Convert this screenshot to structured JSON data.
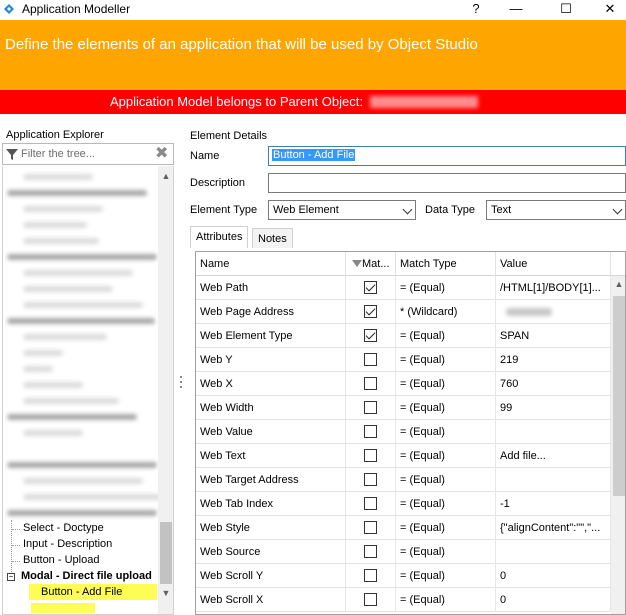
{
  "window": {
    "title": "Application Modeller",
    "help_glyph": "?",
    "minimize_glyph": "—",
    "maximize_glyph": "☐",
    "close_glyph": "✕"
  },
  "banner": {
    "text": "Define the elements of an application that will be used by Object Studio",
    "color": "#ffa500"
  },
  "parent_bar": {
    "text": "Application Model belongs to Parent Object:",
    "color": "#fe0000"
  },
  "explorer": {
    "label": "Application Explorer",
    "filter_placeholder": "Filter the tree...",
    "clear_glyph": "✖",
    "items": [
      {
        "label": "Select - Doctype"
      },
      {
        "label": "Input - Description"
      },
      {
        "label": "Button - Upload"
      },
      {
        "label": "Modal - Direct file upload",
        "expander": "−"
      },
      {
        "label": "Button - Add File",
        "selected": true
      }
    ],
    "selected_color": "#fdfd56"
  },
  "details": {
    "label": "Element Details",
    "name_label": "Name",
    "name_value": "Button - Add File",
    "description_label": "Description",
    "description_value": "",
    "element_type_label": "Element Type",
    "element_type_value": "Web Element",
    "data_type_label": "Data Type",
    "data_type_value": "Text"
  },
  "tabs": [
    {
      "label": "Attributes",
      "active": true
    },
    {
      "label": "Notes",
      "active": false
    }
  ],
  "grid": {
    "columns": [
      "Name",
      "Mat...",
      "Match Type",
      "Value"
    ],
    "rows": [
      {
        "name": "Web Path",
        "match": true,
        "type": "=  (Equal)",
        "value": "/HTML[1]/BODY[1]..."
      },
      {
        "name": "Web Page Address",
        "match": true,
        "type": "*  (Wildcard)",
        "value": ""
      },
      {
        "name": "Web Element Type",
        "match": true,
        "type": "=  (Equal)",
        "value": "SPAN"
      },
      {
        "name": "Web Y",
        "match": false,
        "type": "=  (Equal)",
        "value": "219"
      },
      {
        "name": "Web X",
        "match": false,
        "type": "=  (Equal)",
        "value": "760"
      },
      {
        "name": "Web Width",
        "match": false,
        "type": "=  (Equal)",
        "value": "99"
      },
      {
        "name": "Web Value",
        "match": false,
        "type": "=  (Equal)",
        "value": ""
      },
      {
        "name": "Web Text",
        "match": false,
        "type": "=  (Equal)",
        "value": " Add file..."
      },
      {
        "name": "Web Target Address",
        "match": false,
        "type": "=  (Equal)",
        "value": ""
      },
      {
        "name": "Web Tab Index",
        "match": false,
        "type": "=  (Equal)",
        "value": "-1"
      },
      {
        "name": "Web Style",
        "match": false,
        "type": "=  (Equal)",
        "value": "{\"alignContent\":\"\",\"..."
      },
      {
        "name": "Web Source",
        "match": false,
        "type": "=  (Equal)",
        "value": ""
      },
      {
        "name": "Web Scroll Y",
        "match": false,
        "type": "=  (Equal)",
        "value": "0"
      },
      {
        "name": "Web Scroll X",
        "match": false,
        "type": "=  (Equal)",
        "value": "0"
      }
    ]
  }
}
